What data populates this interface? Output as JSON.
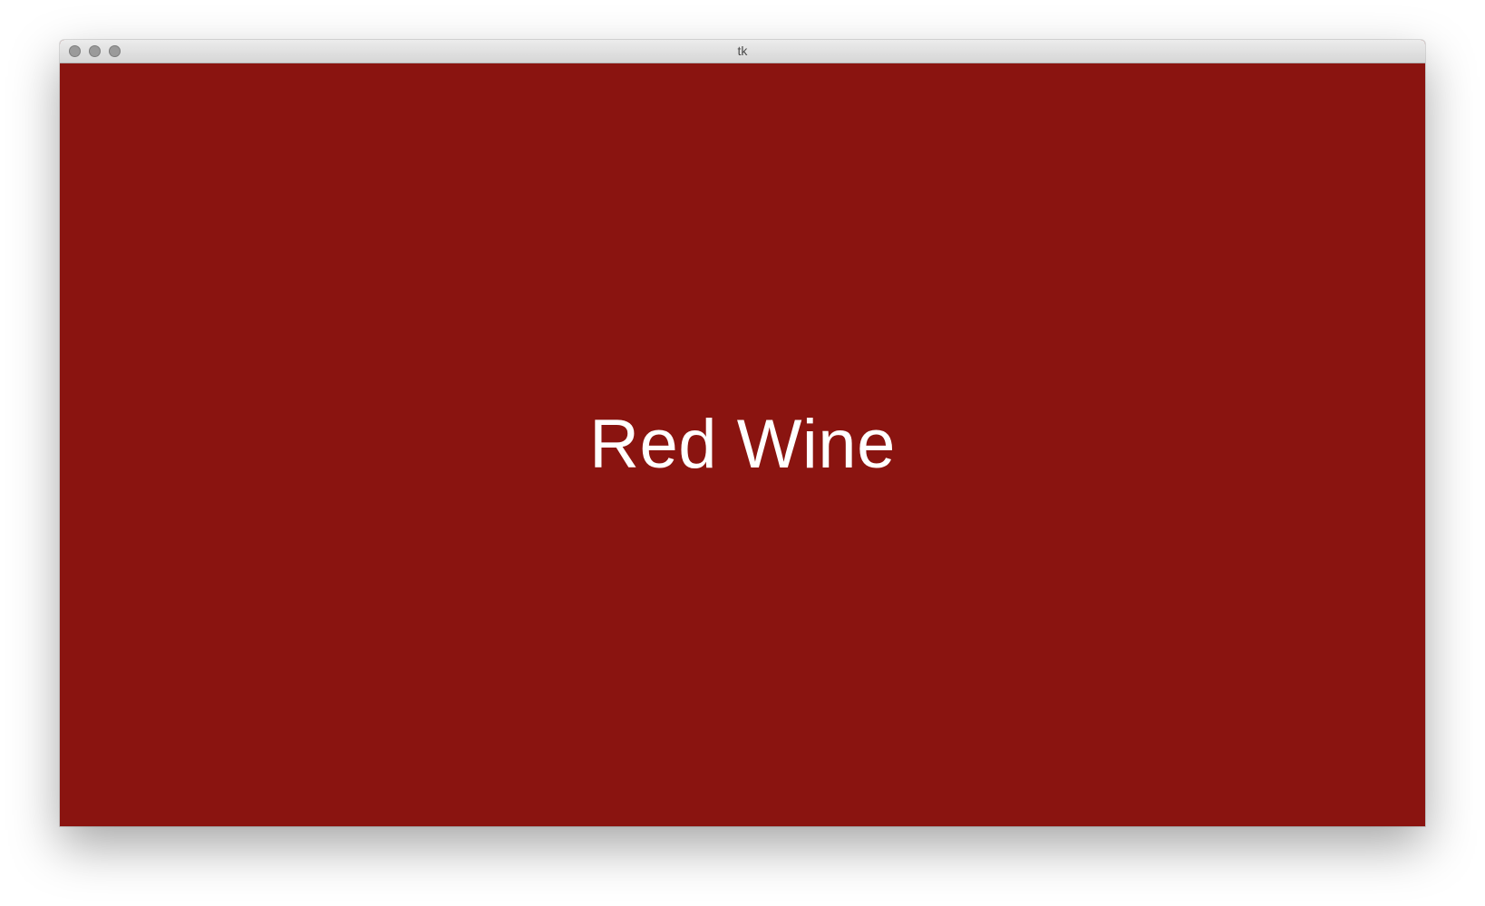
{
  "window": {
    "title": "tk",
    "content_background": "#8a1410"
  },
  "titlebar": {
    "buttons": [
      {
        "icon": "close-circle-icon"
      },
      {
        "icon": "minimize-circle-icon"
      },
      {
        "icon": "zoom-circle-icon"
      }
    ]
  },
  "content": {
    "label": "Red Wine",
    "text_color": "#ffffff"
  }
}
